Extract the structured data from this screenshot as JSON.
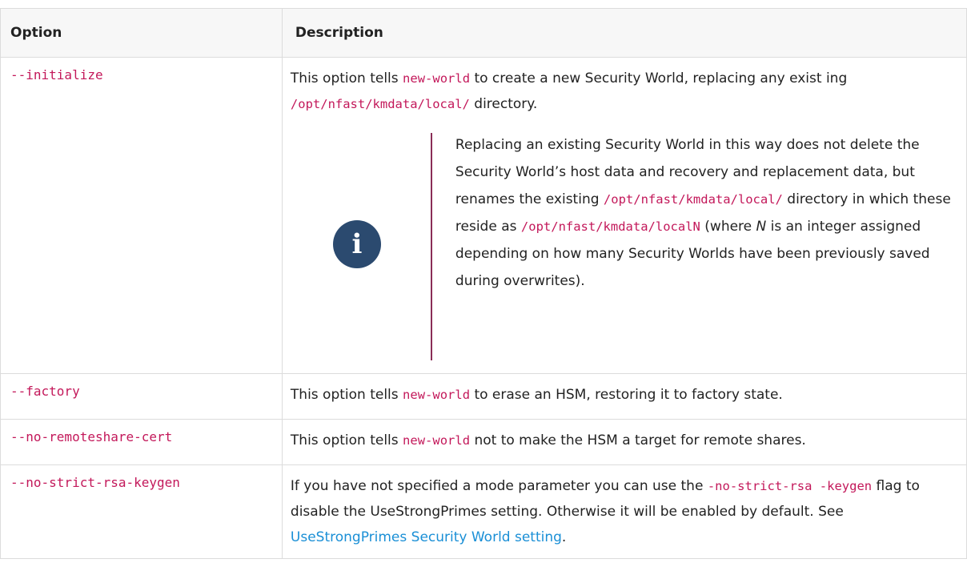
{
  "table": {
    "header": {
      "option": "Option",
      "description": "Description"
    },
    "rows": {
      "initialize": {
        "option": "--initialize",
        "d1": "This option tells ",
        "d2": "new-world",
        "d3": " to create a new Security World, replacing any exist ing ",
        "d4": "/opt/nfast/kmdata/local/",
        "d5": " directory.",
        "note": {
          "icon": "info-icon",
          "n1": "Replacing an existing Security World in this way does not delete the Security World’s host data and recovery and replacement data, but renames the existing ",
          "n2": "/opt/nfast/kmdata/local/",
          "n3": " directory in which these reside as ",
          "n4": "/opt/nfast/kmdata/localN",
          "n5": " (where ",
          "n6": "N",
          "n7": " is an integer assigned depending on how many Security Worlds have been previously saved during overwrites)."
        }
      },
      "factory": {
        "option": "--factory",
        "d1": "This option tells ",
        "d2": "new-world",
        "d3": " to erase an HSM, restoring it to factory state."
      },
      "no_remoteshare_cert": {
        "option": "--no-remoteshare-cert",
        "d1": "This option tells ",
        "d2": "new-world",
        "d3": " not to make the HSM a target for remote shares."
      },
      "no_strict_rsa_keygen": {
        "option": "--no-strict-rsa-keygen",
        "d1": "If you have not specified a mode parameter you can use the ",
        "d2": "-no-strict-rsa -keygen",
        "d3": " flag to disable the UseStrongPrimes setting. Otherwise it will be enabled by default. See ",
        "link": "UseStrongPrimes Security World setting",
        "d4": "."
      }
    }
  }
}
